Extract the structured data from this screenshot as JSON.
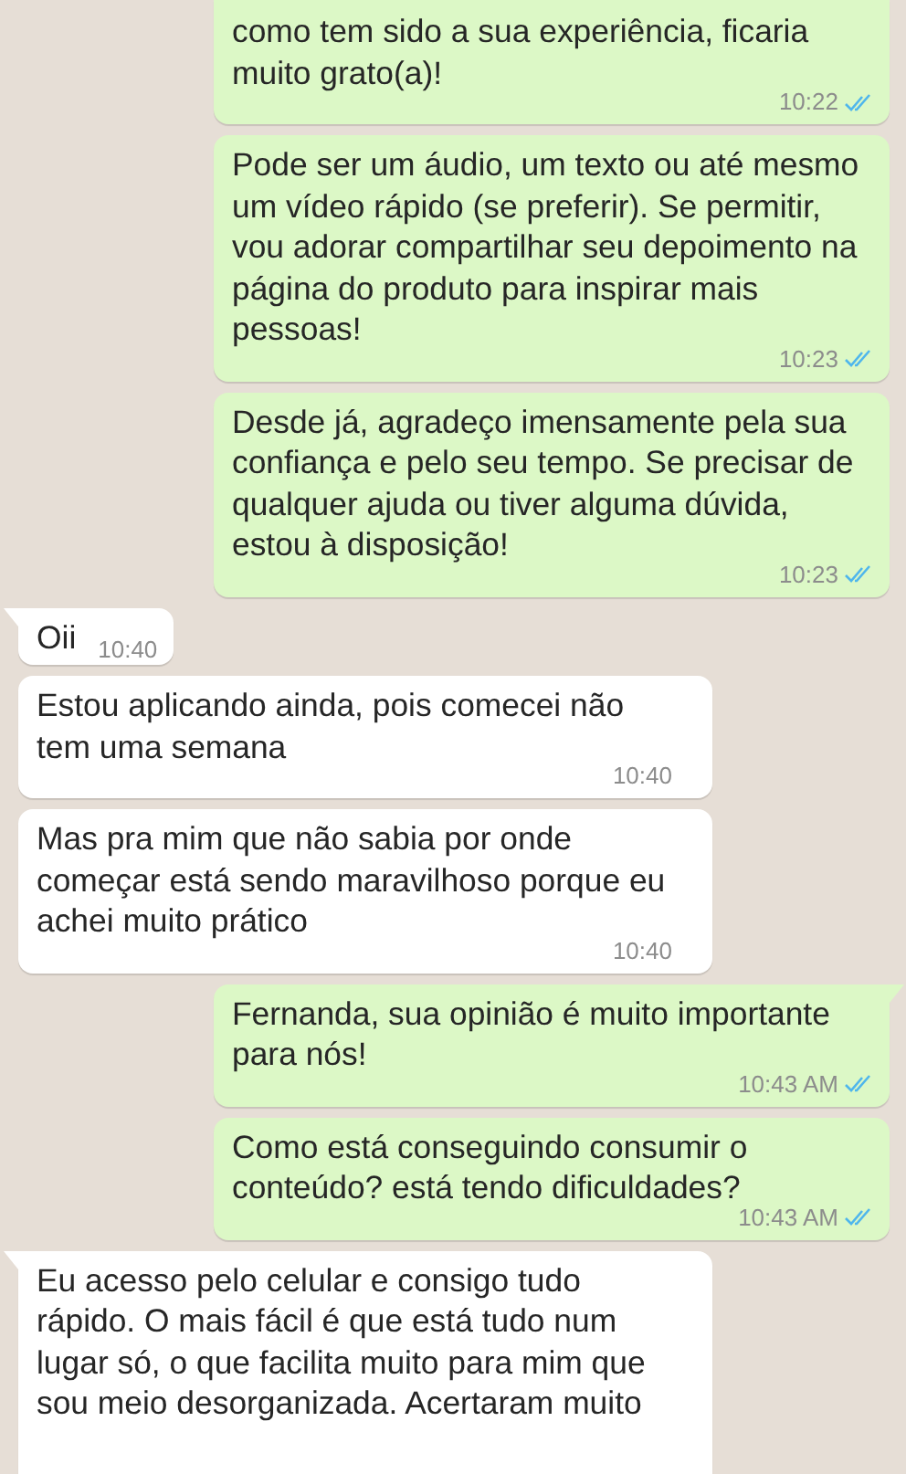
{
  "messages": [
    {
      "kind": "out",
      "tail": false,
      "text": "como tem sido a sua experiência, ficaria muito grato(a)!",
      "time": "10:22",
      "read": true
    },
    {
      "kind": "out",
      "tail": false,
      "text": "Pode ser um áudio, um texto ou até mesmo um vídeo rápido (se preferir). Se permitir, vou adorar compartilhar seu depoimento na página do produto para inspirar mais pessoas!",
      "time": "10:23",
      "read": true
    },
    {
      "kind": "out",
      "tail": false,
      "text": "Desde já, agradeço imensamente pela sua confiança e pelo seu tempo. Se precisar de qualquer ajuda ou tiver alguma dúvida, estou à disposição!",
      "time": "10:23",
      "read": true
    },
    {
      "kind": "in",
      "tail": true,
      "text": "Oii",
      "time": "10:40"
    },
    {
      "kind": "in",
      "tail": false,
      "text": "Estou aplicando ainda, pois comecei não tem uma semana",
      "time": "10:40"
    },
    {
      "kind": "in",
      "tail": false,
      "text": "Mas pra mim que não sabia por onde começar está sendo maravilhoso porque eu achei muito prático",
      "time": "10:40"
    },
    {
      "kind": "out",
      "tail": true,
      "text": "Fernanda, sua opinião é muito importante para nós!",
      "time": "10:43 AM",
      "read": true
    },
    {
      "kind": "out",
      "tail": false,
      "text": "Como está conseguindo consumir o conteúdo? está tendo dificuldades?",
      "time": "10:43 AM",
      "read": true
    },
    {
      "kind": "in",
      "tail": true,
      "text": "Eu acesso pelo celular e consigo tudo rápido. O mais fácil é que está tudo num lugar só, o que facilita muito para mim que sou meio desorganizada. Acertaram muito"
    }
  ]
}
